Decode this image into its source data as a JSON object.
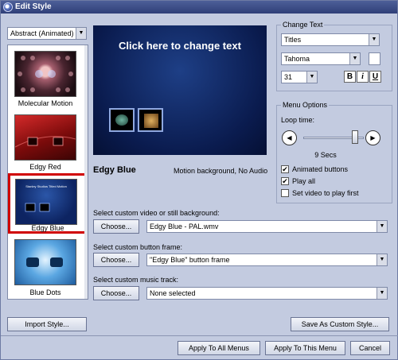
{
  "window": {
    "title": "Edit Style"
  },
  "style_list": {
    "category_select": "Abstract (Animated)",
    "items": [
      {
        "label": "Molecular Motion"
      },
      {
        "label": "Edgy Red"
      },
      {
        "label": "Edgy Blue",
        "selected": true
      },
      {
        "label": "Blue Dots"
      }
    ]
  },
  "preview": {
    "overlay_text": "Click here to change text",
    "mini_text": "Stanley Studios Titled Motion",
    "style_name": "Edgy Blue",
    "style_desc": "Motion background, No Audio"
  },
  "change_text": {
    "group_title": "Change Text",
    "target_select": "Titles",
    "font_select": "Tahoma",
    "size_select": "31",
    "bold_label": "B",
    "italic_label": "i",
    "underline_label": "U"
  },
  "menu_options": {
    "group_title": "Menu Options",
    "loop_label": "Loop time:",
    "loop_value": "9 Secs",
    "loop_fraction": 0.9,
    "animated_buttons_label": "Animated buttons",
    "animated_buttons_checked": true,
    "play_all_label": "Play all",
    "play_all_checked": true,
    "video_first_label": "Set video to play first",
    "video_first_checked": false
  },
  "background": {
    "label": "Select custom video or still background:",
    "choose_label": "Choose...",
    "value": "Edgy Blue - PAL.wmv"
  },
  "button_frame": {
    "label": "Select custom button frame:",
    "choose_label": "Choose...",
    "value": "\"Edgy Blue\" button frame"
  },
  "music": {
    "label": "Select custom music track:",
    "choose_label": "Choose...",
    "value": "None selected"
  },
  "buttons": {
    "import_style": "Import Style...",
    "save_custom": "Save As Custom Style...",
    "apply_all": "Apply To All Menus",
    "apply_this": "Apply To This Menu",
    "cancel": "Cancel"
  },
  "colors": {
    "window_bg": "#c3cbe0",
    "title_bar": "#2f3f78",
    "selection_border": "#d00000",
    "preview_bg": "#0a1b4e"
  }
}
